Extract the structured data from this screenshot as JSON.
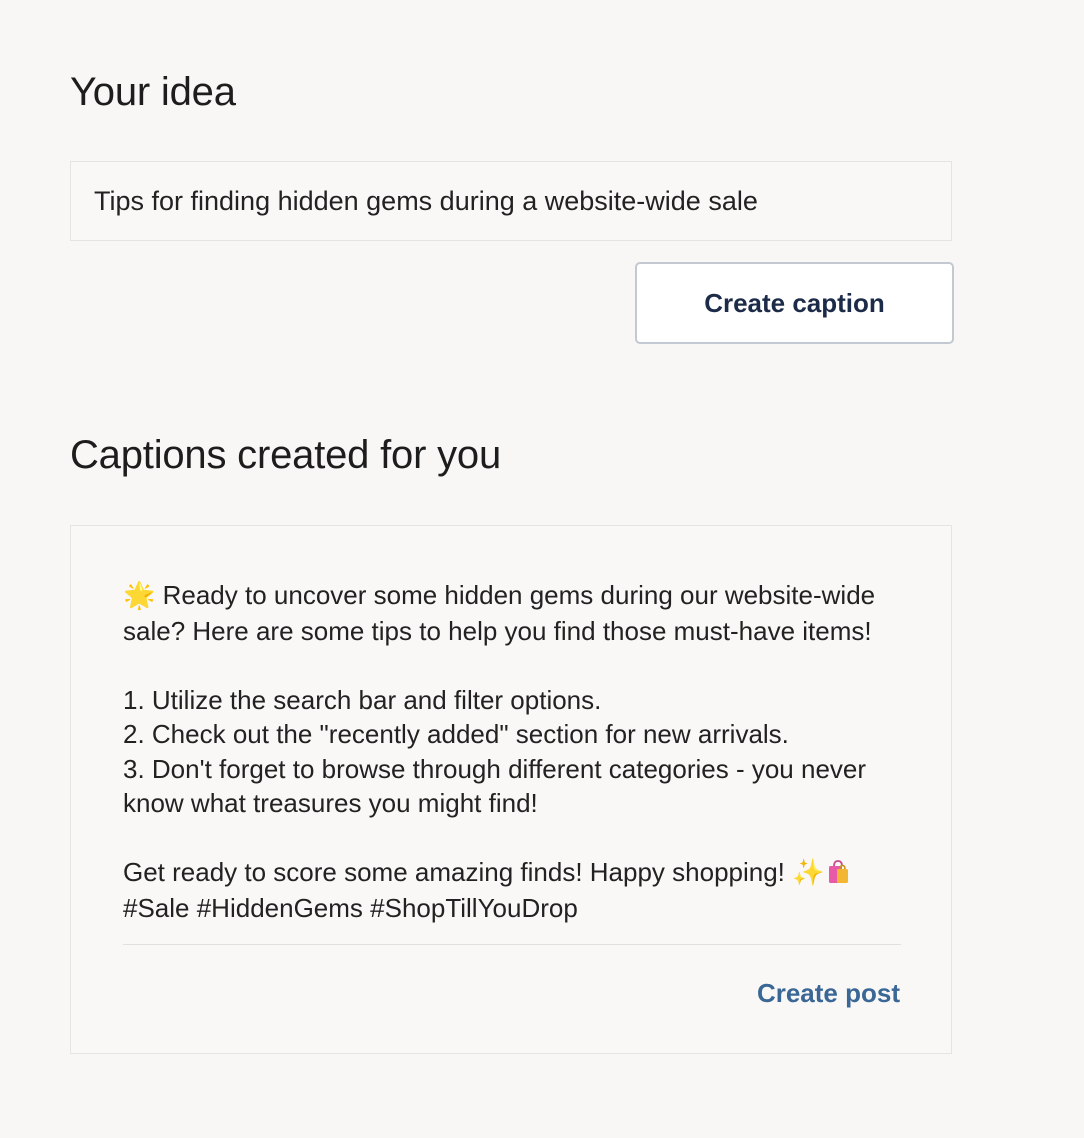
{
  "idea_section": {
    "heading": "Your idea",
    "input_value": "Tips for finding hidden gems during a website-wide sale",
    "button_label": "Create caption"
  },
  "captions_section": {
    "heading": "Captions created for you",
    "caption": {
      "intro_emoji": "🌟",
      "intro": "Ready to uncover some hidden gems during our website-wide sale? Here are some tips to help you find those must-have items!",
      "tips": [
        "1. Utilize the search bar and filter options.",
        "2. Check out the \"recently added\" section for new arrivals.",
        "3. Don't forget to browse through different categories - you never know what treasures you might find!"
      ],
      "closing": "Get ready to score some amazing finds! Happy shopping!",
      "closing_emoji_sparkles": "✨",
      "closing_emoji_bags": "🛍️",
      "hashtags": "#Sale #HiddenGems #ShopTillYouDrop"
    },
    "action_label": "Create post"
  },
  "colors": {
    "background": "#f8f7f6",
    "button_text": "#1c2b47",
    "link": "#3a6796"
  }
}
